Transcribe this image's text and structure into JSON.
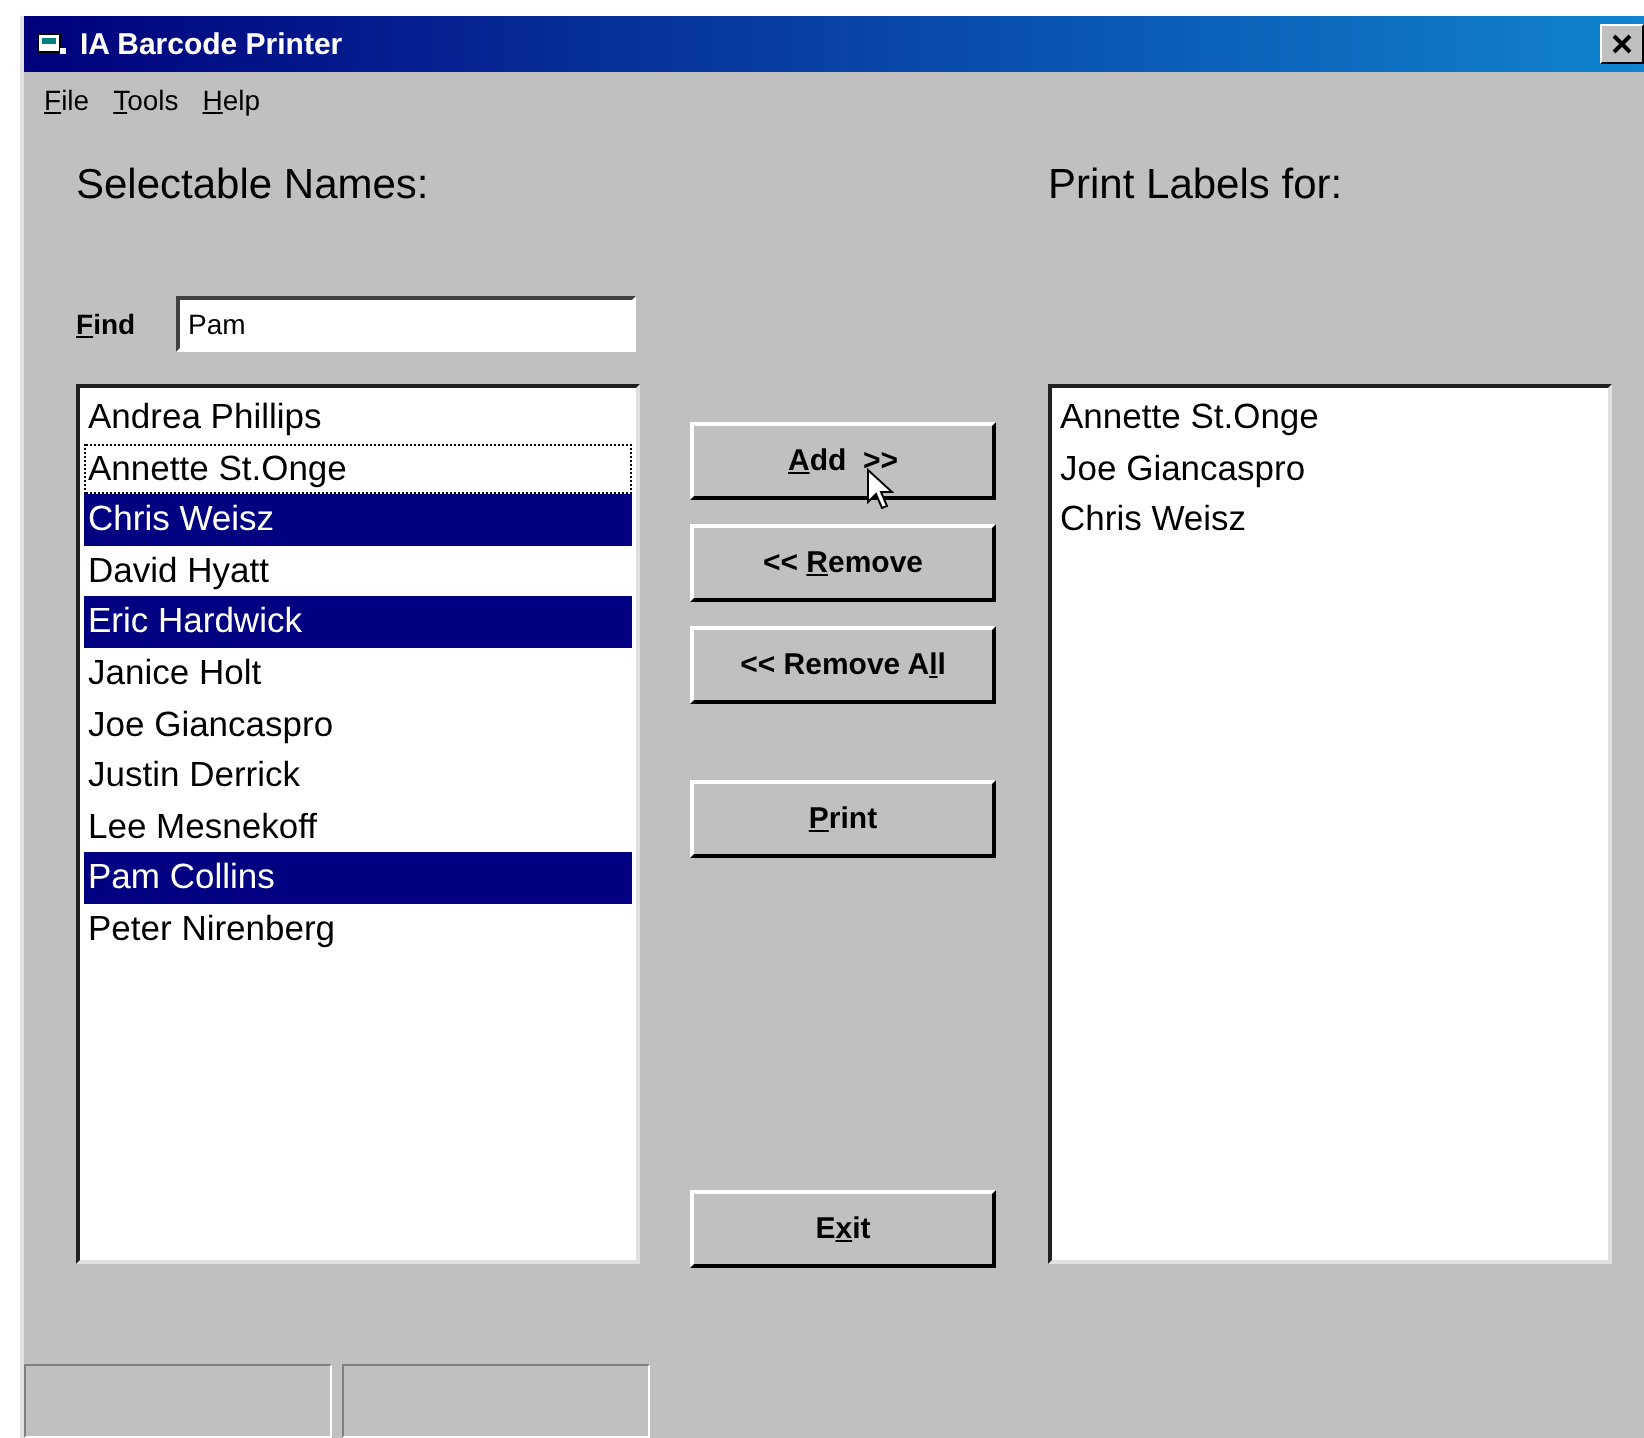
{
  "window": {
    "title": "IA Barcode Printer"
  },
  "menu": [
    {
      "key": "F",
      "rest": "ile"
    },
    {
      "key": "T",
      "rest": "ools"
    },
    {
      "key": "H",
      "rest": "elp"
    }
  ],
  "selectable": {
    "heading": "Selectable Names:",
    "find": {
      "label_key": "F",
      "label_rest": "ind",
      "value": "Pam"
    },
    "items": [
      {
        "name": "Andrea Phillips",
        "selected": false,
        "focused": false
      },
      {
        "name": "Annette St.Onge",
        "selected": false,
        "focused": true
      },
      {
        "name": "Chris Weisz",
        "selected": true,
        "focused": false
      },
      {
        "name": "David Hyatt",
        "selected": false,
        "focused": false
      },
      {
        "name": "Eric Hardwick",
        "selected": true,
        "focused": false
      },
      {
        "name": "Janice Holt",
        "selected": false,
        "focused": false
      },
      {
        "name": "Joe Giancaspro",
        "selected": false,
        "focused": false
      },
      {
        "name": "Justin Derrick",
        "selected": false,
        "focused": false
      },
      {
        "name": "Lee Mesnekoff",
        "selected": false,
        "focused": false
      },
      {
        "name": "Pam Collins",
        "selected": true,
        "focused": false
      },
      {
        "name": "Peter Nirenberg",
        "selected": false,
        "focused": false
      }
    ]
  },
  "buttons": [
    {
      "kind": "add",
      "key": "A",
      "after": "dd  >>"
    },
    {
      "kind": "remove",
      "before": "<< ",
      "key": "R",
      "after": "emove"
    },
    {
      "kind": "remove-all",
      "before": "<< Remove A",
      "key": "l",
      "after": "l"
    },
    {
      "kind": "print",
      "key": "P",
      "after": "rint"
    },
    {
      "kind": "exit",
      "before": "E",
      "key": "x",
      "after": "it"
    }
  ],
  "print_labels": {
    "heading": "Print Labels for:",
    "items": [
      "Annette St.Onge",
      "Joe Giancaspro",
      "Chris Weisz"
    ]
  }
}
